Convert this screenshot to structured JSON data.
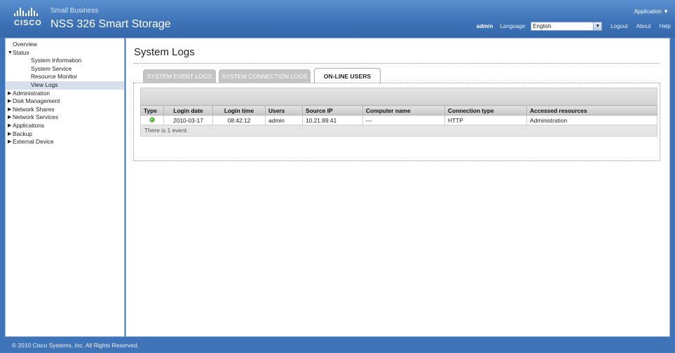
{
  "brand": {
    "logo_word": "CISCO",
    "small_business": "Small Business",
    "product": "NSS 326 Smart Storage"
  },
  "topbar": {
    "app_menu": "Application ▼",
    "user": "admin",
    "language_label": "Language:",
    "language_value": "English",
    "logout": "Logout",
    "about": "About",
    "help": "Help"
  },
  "sidebar": {
    "items": [
      {
        "label": "Overview",
        "level": 0,
        "expander": ""
      },
      {
        "label": "Status",
        "level": 0,
        "expander": "expanded"
      },
      {
        "label": "System Information",
        "level": 1
      },
      {
        "label": "System Service",
        "level": 1
      },
      {
        "label": "Resource Monitor",
        "level": 1
      },
      {
        "label": "View Logs",
        "level": 1,
        "active": true
      },
      {
        "label": "Administration",
        "level": 0,
        "expander": "collapsed"
      },
      {
        "label": "Disk Management",
        "level": 0,
        "expander": "collapsed"
      },
      {
        "label": "Network Shares",
        "level": 0,
        "expander": "collapsed"
      },
      {
        "label": "Network Services",
        "level": 0,
        "expander": "collapsed"
      },
      {
        "label": "Applications",
        "level": 0,
        "expander": "collapsed"
      },
      {
        "label": "Backup",
        "level": 0,
        "expander": "collapsed"
      },
      {
        "label": "External Device",
        "level": 0,
        "expander": "collapsed"
      }
    ]
  },
  "main": {
    "title": "System Logs",
    "tabs": [
      {
        "label": "SYSTEM EVENT LOGS",
        "active": false
      },
      {
        "label": "SYSTEM CONNECTION LOGS",
        "active": false
      },
      {
        "label": "ON-LINE USERS",
        "active": true
      }
    ],
    "table": {
      "headers": [
        "Type",
        "Login date",
        "Login time",
        "Users",
        "Source IP",
        "Computer name",
        "Connection type",
        "Accessed resources"
      ],
      "rows": [
        {
          "type_icon": "online-status-icon",
          "login_date": "2010-03-17",
          "login_time": "08:42:12",
          "user": "admin",
          "source_ip": "10.21.89.41",
          "computer_name": "---",
          "connection_type": "HTTP",
          "accessed_resources": "Administration"
        }
      ]
    },
    "event_count_text": "There is 1 event."
  },
  "footer": {
    "copyright": "© 2010 Cisco Systems, Inc. All Rights Reserved."
  },
  "colors": {
    "header_blue": "#3f74b8",
    "status_green": "#3ea321"
  }
}
